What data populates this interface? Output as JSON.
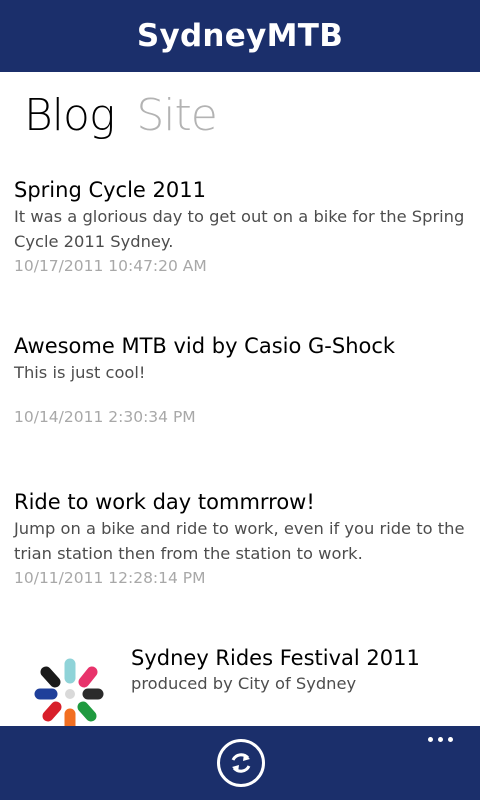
{
  "app": {
    "title": "SydneyMTB"
  },
  "pivot": {
    "tabs": [
      "Blog",
      "Site"
    ],
    "active": "Blog"
  },
  "posts": [
    {
      "title": "Spring Cycle 2011",
      "body": "It was a glorious day to get out on a bike for the Spring Cycle 2011 Sydney.",
      "date": "10/17/2011 10:47:20 AM"
    },
    {
      "title": "Awesome MTB vid by Casio G-Shock",
      "body": "This is just cool!",
      "date": "10/14/2011 2:30:34 PM"
    },
    {
      "title": "Ride to work day tommrrow!",
      "body": "Jump on a bike and ride to work, even if you ride to the trian station then from the station to work.",
      "date": "10/11/2011 12:28:14 PM"
    }
  ],
  "promo": {
    "title": "Sydney Rides Festival 2011",
    "subtitle": "produced by City of Sydney",
    "logo_icon": "city-of-sydney-logo"
  },
  "app_bar": {
    "refresh_icon": "refresh-icon",
    "more_icon": "ellipsis-icon"
  },
  "colors": {
    "brand": "#1b2f6b",
    "pivot_active": "#000000",
    "pivot_inactive": "#b3b3b3",
    "body_text": "#4d4d4d",
    "date_text": "#a8a8a8"
  }
}
